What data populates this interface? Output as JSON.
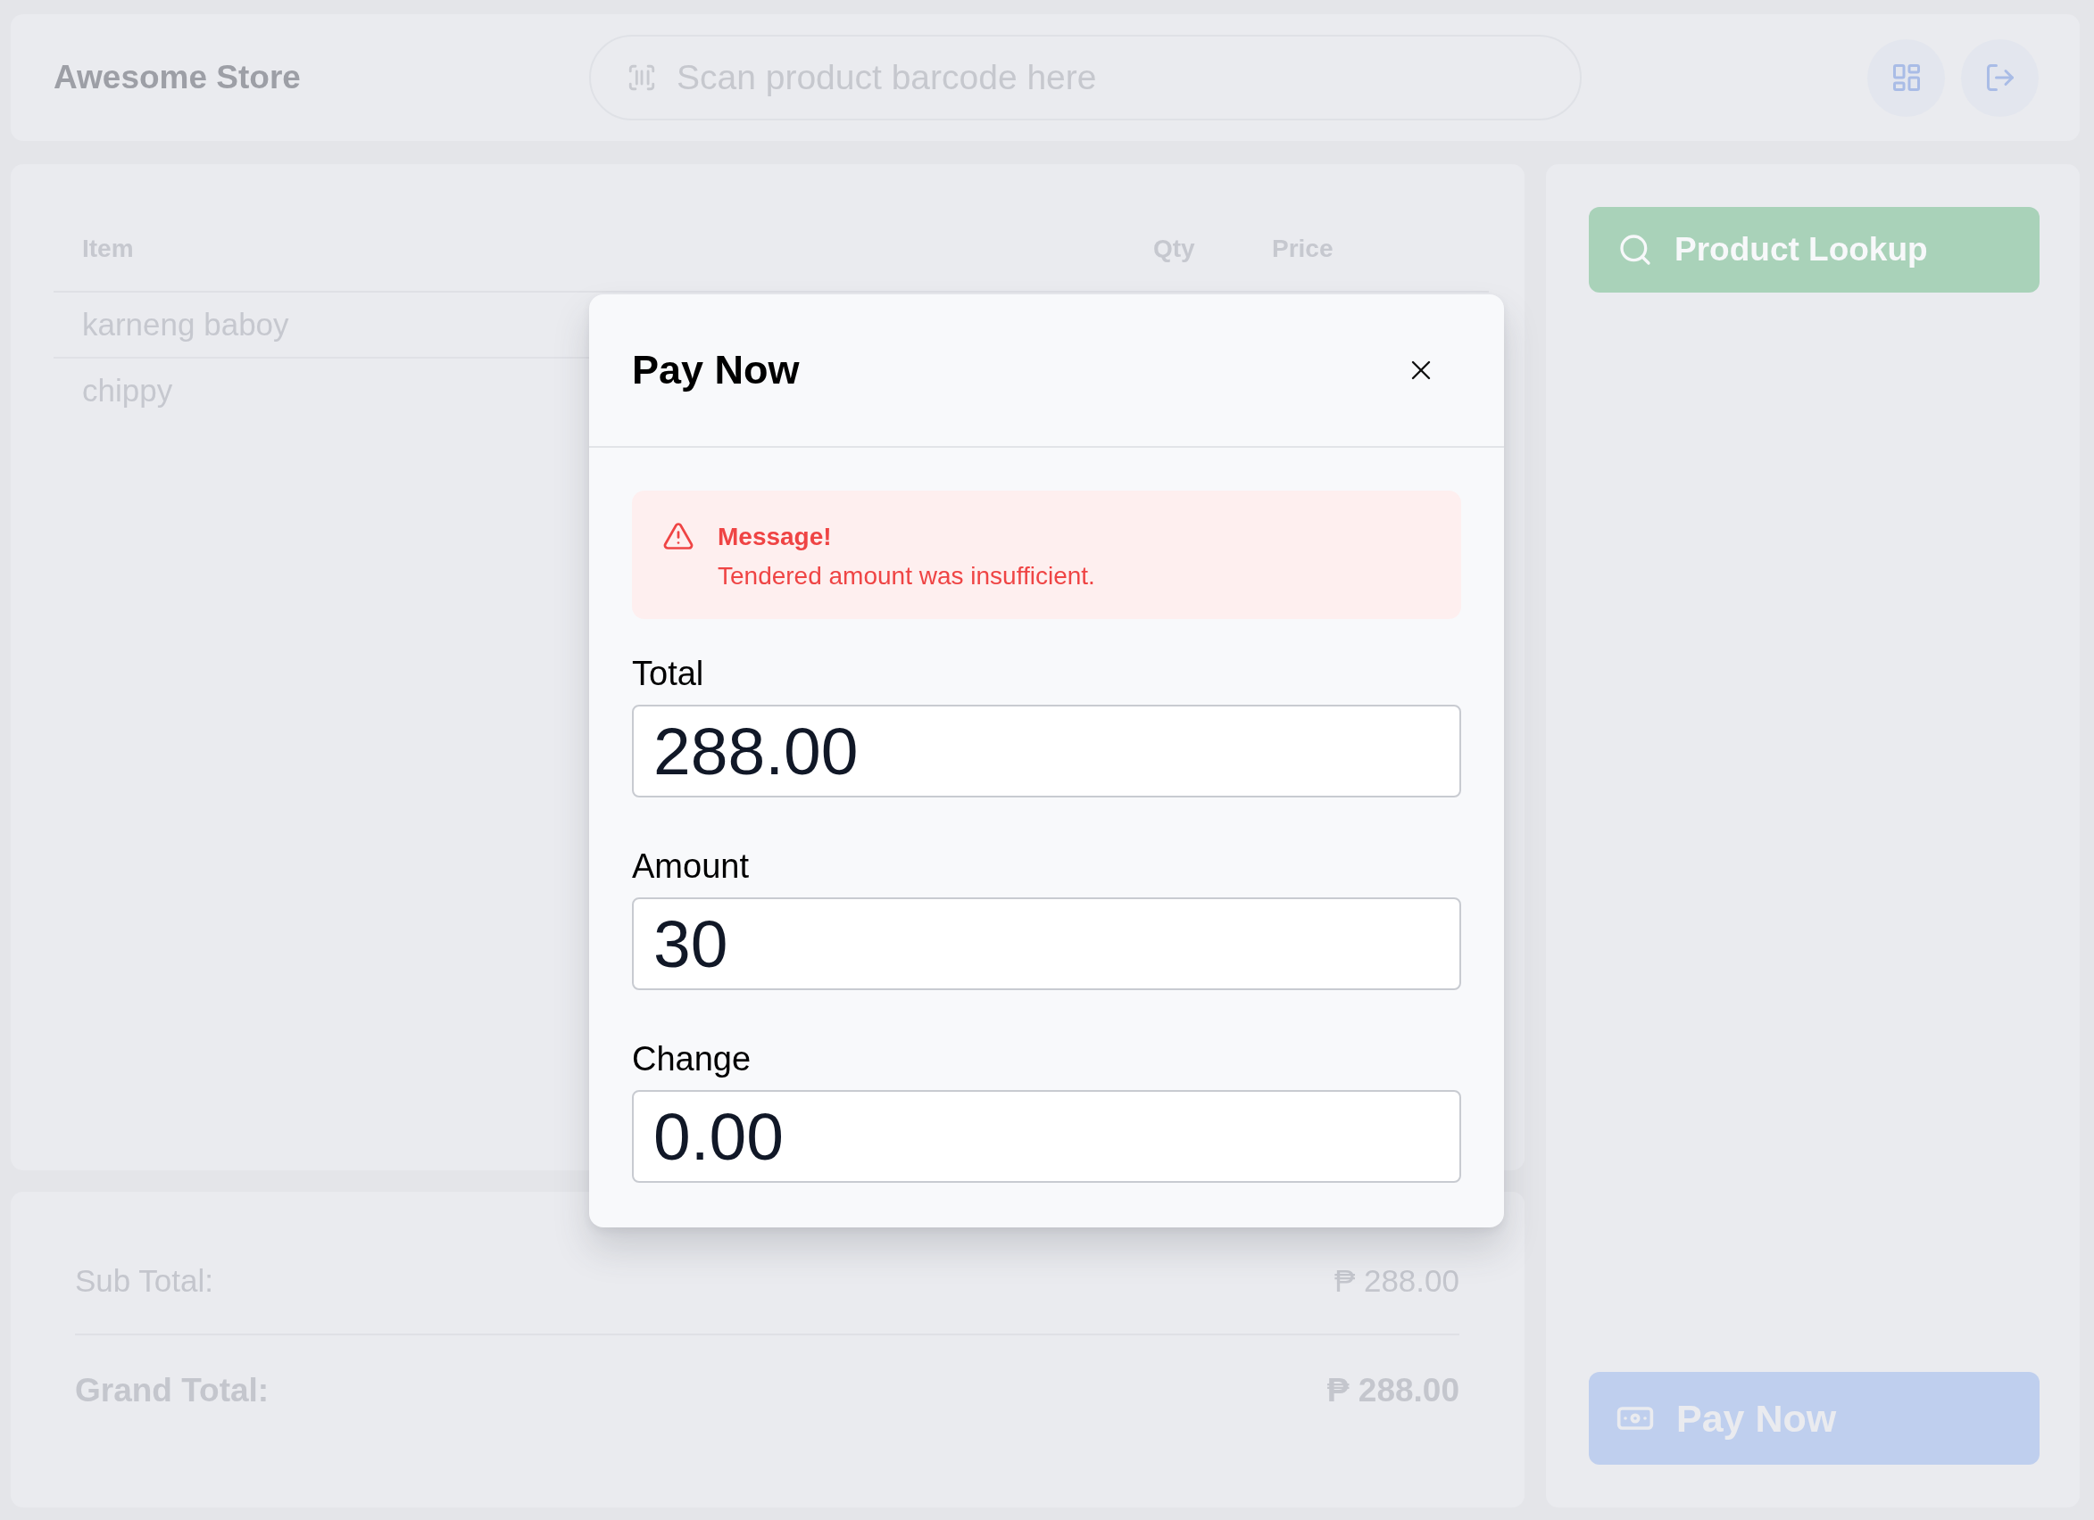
{
  "header": {
    "store_name": "Awesome Store",
    "barcode_search": {
      "placeholder": "Scan product barcode here"
    }
  },
  "cart": {
    "columns": [
      "Item",
      "Qty",
      "Price"
    ],
    "rows": [
      {
        "item": "karneng baboy"
      },
      {
        "item": "chippy"
      }
    ]
  },
  "totals": [
    {
      "kind": "subtotal",
      "label": "Sub Total:",
      "value": "₱ 288.00"
    },
    {
      "kind": "grand",
      "label": "Grand Total:",
      "value": "₱ 288.00"
    }
  ],
  "sidebar": {
    "product_lookup_button": "Product Lookup",
    "pay_now_button": "Pay Now"
  },
  "payment_dialog": {
    "title": "Pay Now",
    "alert": {
      "title": "Message!",
      "text": "Tendered amount was insufficient."
    },
    "fields": [
      {
        "label": "Total",
        "value": "288.00"
      },
      {
        "label": "Amount",
        "value": "30"
      },
      {
        "label": "Change",
        "value": "0.00"
      }
    ]
  }
}
